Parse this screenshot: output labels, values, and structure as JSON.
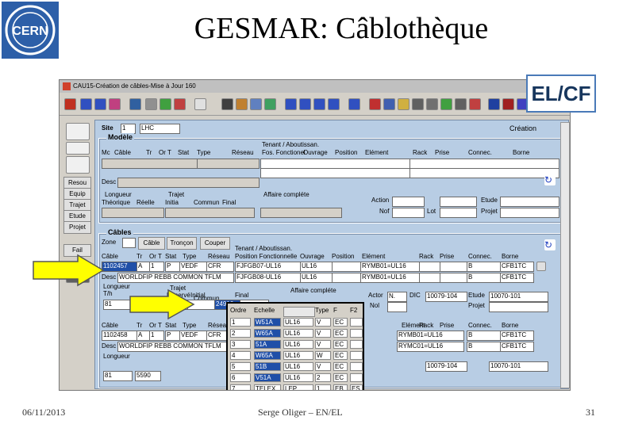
{
  "slide": {
    "title": "GESMAR: Câblothèque",
    "badge": "EL/CF",
    "date": "06/11/2013",
    "presenter": "Serge Oliger – EN/EL",
    "page": "31",
    "logo_text": "CERN"
  },
  "window": {
    "title": "CAU15-Création de câbles-Mise à Jour 160"
  },
  "sidebar": {
    "items": [
      "Resou",
      "Equip",
      "Trajet",
      "Etude",
      "Projet",
      "Fail"
    ]
  },
  "site": {
    "label": "Site",
    "value": "1",
    "code": "LHC",
    "mode": "Création"
  },
  "modele": {
    "title": "Modèle",
    "headers": [
      "Mc",
      "Câble",
      "Tr",
      "Or T",
      "Stat",
      "Type",
      "Réseau",
      "Fos. Fonctionel",
      "Ouvrage",
      "Position",
      "Elément",
      "Rack",
      "Prise",
      "Connec.",
      "Borne"
    ],
    "desc_label": "Desc",
    "tenant_label": "Tenant / Aboutissan.",
    "longueur_label": "Longueur",
    "longueur_cols": [
      "Théorique",
      "Réelle"
    ],
    "trajet_label": "Trajet",
    "trajet_cols": [
      "Initia",
      "Commun",
      "Final"
    ],
    "affaire_label": "Affaire compléte",
    "action_label": "Action",
    "nof_label": "Nof",
    "lot_label": "Lot",
    "etude_label": "Etude",
    "projet_label": "Projet"
  },
  "cables": {
    "title": "Câbles",
    "zone_label": "Zone",
    "tabs": [
      "Câble",
      "Tronçon",
      "Couper"
    ],
    "headers": [
      "Câble",
      "Tr",
      "Or T",
      "Stat",
      "Type",
      "Réseau",
      "Position Fonctionnelle",
      "Ouvrage",
      "Position",
      "Elément",
      "Rack",
      "Prise",
      "Connec.",
      "Borne"
    ],
    "tenant_label": "Tenant / Aboutissan.",
    "row1": {
      "cable": "1102457",
      "tr": "A",
      "ort": "1",
      "stat": "P",
      "type": "VEDF",
      "reseau": "CFR",
      "pos1": "FJFGB07-UL16",
      "ouv1": "UL16",
      "elem1": "RYMB01=UL16",
      "con1": "B",
      "borne1": "CFB1TC",
      "pos2": "FJFGB08-UL16",
      "ouv2": "UL16",
      "elem2": "RYMB01=UL16",
      "con2": "B",
      "borne2": "CFB1TC"
    },
    "desc_label": "Desc",
    "desc_value": "WORLDFIP REBB COMMON TFLM",
    "longueur_label": "Longueur",
    "tth_label": "T/h",
    "tth_value": "81",
    "trajet_label": "Trajet",
    "trajet_cols": [
      "Réservé",
      "Initial",
      "Commun",
      "Final"
    ],
    "commun_value": "24916",
    "affaire_label": "Affaire compléte",
    "actor_label": "Actor",
    "actor_value": "N.",
    "dic_label": "DIC",
    "dic_value": "10079-104",
    "nol_label": "Nol",
    "etude_label": "Etude",
    "etude_value": "10070-101",
    "projet_label": "Projet"
  },
  "cables2": {
    "headers": [
      "Câble",
      "Tr",
      "Or T",
      "Stat",
      "Type",
      "Réseau"
    ],
    "row1": {
      "cable": "1102458",
      "tr": "A",
      "ort": "1",
      "stat": "P",
      "type": "VEDF",
      "reseau": "CFR"
    },
    "desc_value": "WORLDFIP REBB COMMON TFLM",
    "longueur_label": "Longueur",
    "tth_value": "81",
    "reserve_value": "5590",
    "right_headers": [
      "Elément",
      "Rack",
      "Prise",
      "Connec.",
      "Borne"
    ],
    "elem1": "RYMB01=UL16",
    "con1": "B",
    "borne1": "CFB1TC",
    "elem2": "RYMC01=UL16",
    "con2": "B",
    "borne2": "CFB1TC",
    "dic_value": "10079-104",
    "etude_value": "10070-101"
  },
  "popup": {
    "headers": [
      "Ordre",
      "Echelle",
      "",
      "Type",
      "F",
      "F2"
    ],
    "rows": [
      [
        "1",
        "W51A",
        "UL16",
        "V",
        "EC",
        ""
      ],
      [
        "2",
        "W65A",
        "UL16",
        "V",
        "EC",
        ""
      ],
      [
        "3",
        "51A",
        "UL16",
        "V",
        "EC",
        ""
      ],
      [
        "4",
        "W65A",
        "UL16",
        "W",
        "EC",
        ""
      ],
      [
        "5",
        "51B",
        "UL16",
        "V",
        "EC",
        ""
      ],
      [
        "6",
        "V51A",
        "UL16",
        "2",
        "EC",
        ""
      ],
      [
        "7",
        "TELEX",
        "LEP",
        "1",
        "EB",
        "ES"
      ]
    ]
  },
  "colors": {
    "accent": "#1f4fa8",
    "arrow": "#ffff00",
    "form_bg": "#b8cde4"
  }
}
